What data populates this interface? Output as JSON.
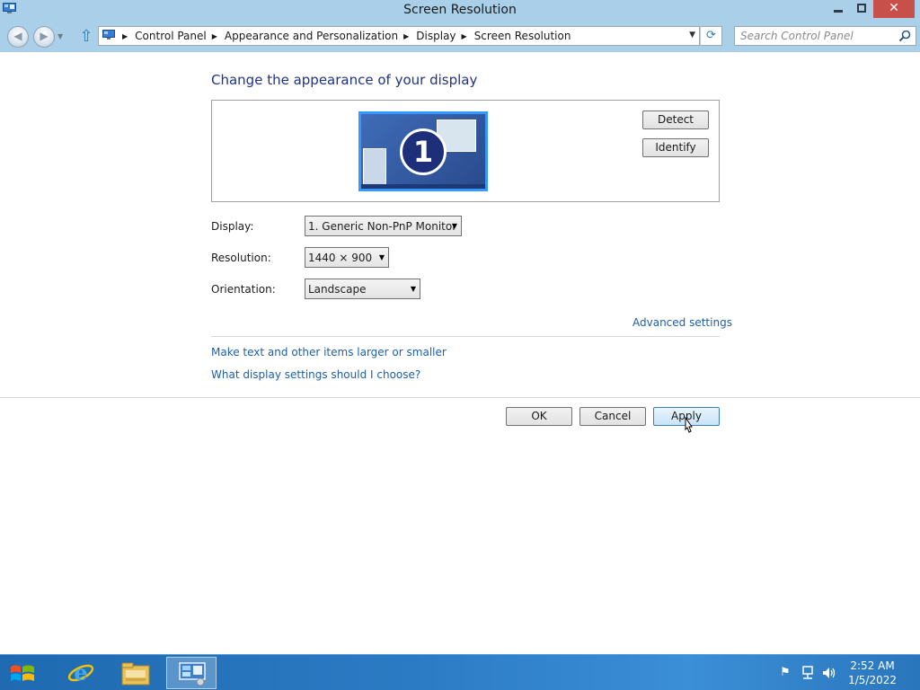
{
  "window": {
    "title": "Screen Resolution",
    "close_glyph": "✕"
  },
  "address": {
    "crumbs": [
      "Control Panel",
      "Appearance and Personalization",
      "Display",
      "Screen Resolution"
    ],
    "search_placeholder": "Search Control Panel"
  },
  "main": {
    "heading": "Change the appearance of your display",
    "monitor_number": "1",
    "detect_label": "Detect",
    "identify_label": "Identify",
    "display_label": "Display:",
    "display_value": "1. Generic Non-PnP Monitor",
    "resolution_label": "Resolution:",
    "resolution_value": "1440 × 900",
    "orientation_label": "Orientation:",
    "orientation_value": "Landscape",
    "advanced_link": "Advanced settings",
    "text_size_link": "Make text and other items larger or smaller",
    "help_link": "What display settings should I choose?"
  },
  "footer": {
    "ok_label": "OK",
    "cancel_label": "Cancel",
    "apply_label": "Apply"
  },
  "taskbar": {
    "time": "2:52 AM",
    "date": "1/5/2022",
    "items": [
      "start-icon",
      "internet-explorer-icon",
      "file-explorer-icon",
      "control-panel-icon"
    ],
    "tray_icons": [
      "flag-icon",
      "network-icon",
      "volume-icon"
    ]
  },
  "colors": {
    "heading": "#1e3287",
    "link": "#1e5fa8",
    "titlebar": "#aacfe8",
    "taskbar": "#2b7bc4",
    "monitor_highlight": "#3399ff"
  }
}
